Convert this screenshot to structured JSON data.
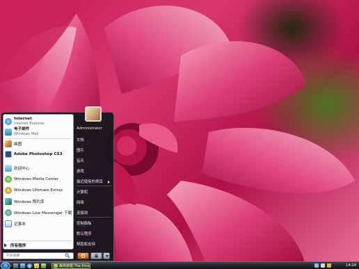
{
  "start_menu": {
    "pinned": [
      {
        "title": "Internet",
        "subtitle": "Internet Explorer",
        "icon": "internet-explorer-icon"
      },
      {
        "title": "电子邮件",
        "subtitle": "Windows Mail",
        "icon": "windows-mail-icon"
      }
    ],
    "recent": [
      {
        "label": "画图",
        "icon": "paint-icon"
      },
      {
        "label": "Adobe Photoshop CS3",
        "icon": "photoshop-icon"
      },
      {
        "label": "欢迎中心",
        "icon": "welcome-center-icon"
      },
      {
        "label": "Windows Media Center",
        "icon": "media-center-icon"
      },
      {
        "label": "Windows Ultimate Extras",
        "icon": "ultimate-extras-icon"
      },
      {
        "label": "Windows 照片库",
        "icon": "photo-gallery-icon"
      },
      {
        "label": "Windows Live Messenger 下载",
        "icon": "messenger-icon"
      },
      {
        "label": "记事本",
        "icon": "notepad-icon"
      }
    ],
    "all_programs_label": "所有程序",
    "search_placeholder": "开始搜索",
    "right_items": [
      "Administrator",
      "文档",
      "图片",
      "音乐",
      "游戏",
      "最近使用的项目",
      "计算机",
      "网络",
      "连接到",
      "控制面板",
      "默认程序",
      "帮助和支持"
    ]
  },
  "taskbar": {
    "active_task_label": "森林家庭 The Emer...",
    "clock": "14:24"
  },
  "colors": {
    "accent": "#1a5fa8",
    "menu_dark": "#12161c",
    "flower_pink": "#d8376f",
    "leaf_green": "#467a1e"
  }
}
